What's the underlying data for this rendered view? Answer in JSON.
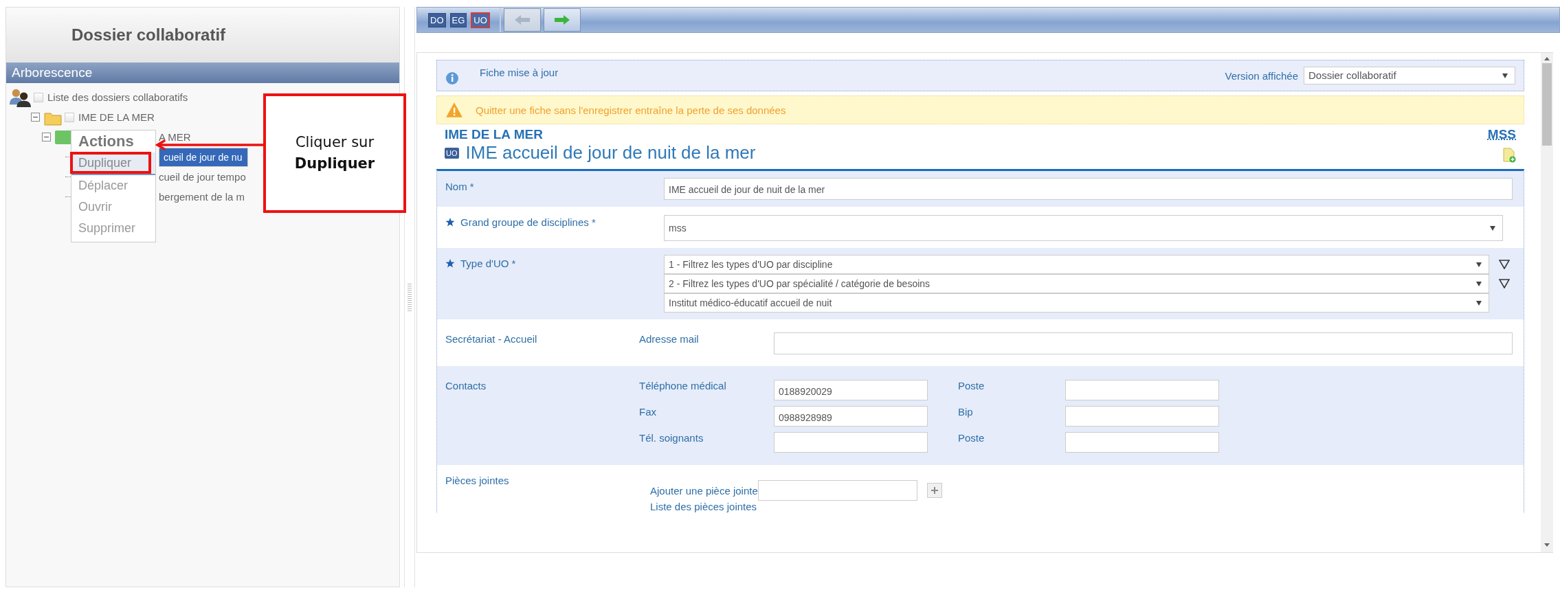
{
  "left_panel": {
    "title": "Dossier collaboratif",
    "section": "Arborescence",
    "tree": [
      {
        "label": "Liste des dossiers collaboratifs",
        "kind": "group",
        "children": [
          {
            "label": "IME DE LA MER",
            "kind": "do",
            "expanded": true,
            "children": [
              {
                "label": "A MER",
                "kind": "eg",
                "expanded": true,
                "children": [
                  {
                    "label": "cueil de jour de nu",
                    "kind": "uo",
                    "selected": true
                  },
                  {
                    "label": "cueil de jour tempo",
                    "kind": "uo",
                    "selected": false
                  },
                  {
                    "label": "bergement de la m",
                    "kind": "uo",
                    "selected": false
                  }
                ]
              }
            ]
          }
        ]
      }
    ]
  },
  "context_menu": {
    "title": "Actions",
    "items": [
      {
        "label": "Dupliquer",
        "selected": true
      },
      {
        "label": "Déplacer",
        "selected": false
      },
      {
        "label": "Ouvrir",
        "selected": false
      },
      {
        "label": "Supprimer",
        "selected": false
      }
    ]
  },
  "callout": {
    "text": "Cliquer sur **Dupliquer**"
  },
  "toolbar": {
    "breadcrumb": [
      {
        "label": "DO",
        "selected": false
      },
      {
        "label": "EG",
        "selected": false
      },
      {
        "label": "UO",
        "selected": true
      }
    ],
    "buttons": [
      {
        "kind": "back",
        "disabled": true
      },
      {
        "kind": "forward",
        "disabled": false
      }
    ]
  },
  "info_bar": {
    "message": "Fiche mise à jour",
    "version_label": "Version affichée",
    "version_value": "Dossier collaboratif"
  },
  "warning_bar": {
    "message": "Quitter une fiche sans l'enregistrer entraîne la perte de ses données"
  },
  "header": {
    "parent": "IME DE LA MER",
    "badge": "UO",
    "title": "IME accueil de jour de nuit de la mer",
    "link": "MSS"
  },
  "form": [
    {
      "kind": "text",
      "label": "Nom *",
      "starred": false,
      "value": "IME accueil de jour de nuit de la mer"
    },
    {
      "kind": "select",
      "label": "Grand groupe de disciplines *",
      "starred": true,
      "values": [
        "mss"
      ]
    },
    {
      "kind": "select",
      "label": "Type d'UO *",
      "starred": true,
      "filters": true,
      "values": [
        "1 - Filtrez les types d'UO par discipline",
        "2 - Filtrez les types d'UO par spécialité / catégorie de besoins",
        "Institut médico-éducatif accueil de nuit"
      ]
    },
    {
      "kind": "fields",
      "label": "Secrétariat - Accueil",
      "starred": false,
      "fields": [
        [
          {
            "label": "Adresse mail"
          }
        ]
      ]
    },
    {
      "kind": "fields",
      "label": "Contacts",
      "starred": false,
      "fields": [
        [
          {
            "label": "Téléphone médical",
            "value": "0188920029"
          },
          {
            "label": "Poste"
          }
        ],
        [
          {
            "label": "Fax",
            "value": "0988928989"
          },
          {
            "label": "Bip"
          }
        ],
        [
          {
            "label": "Tél. soignants"
          },
          {
            "label": "Poste"
          }
        ]
      ]
    },
    {
      "kind": "attachments",
      "label": "Pièces jointes",
      "starred": false,
      "add_label": "Ajouter une pièce jointe",
      "list_label": "Liste des pièces jointes"
    }
  ]
}
